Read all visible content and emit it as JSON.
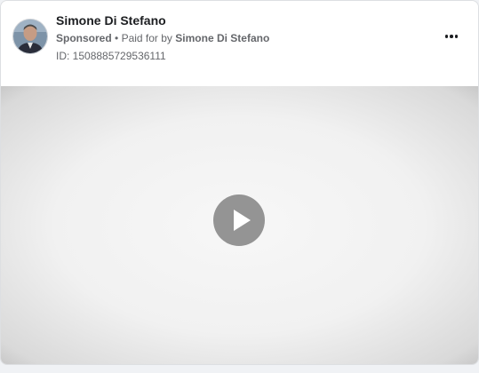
{
  "ad": {
    "page_name": "Simone Di Stefano",
    "sponsored_label": "Sponsored",
    "separator": "•",
    "paid_for_prefix": "Paid for by",
    "paid_for_name": "Simone Di Stefano",
    "id_text": "ID: 1508885729536111"
  },
  "icons": {
    "more": "more-options-icon",
    "play": "play-icon"
  },
  "colors": {
    "primary_text": "#1c1e21",
    "secondary_text": "#65676b",
    "card_background": "#ffffff",
    "page_background": "#f0f2f5"
  }
}
